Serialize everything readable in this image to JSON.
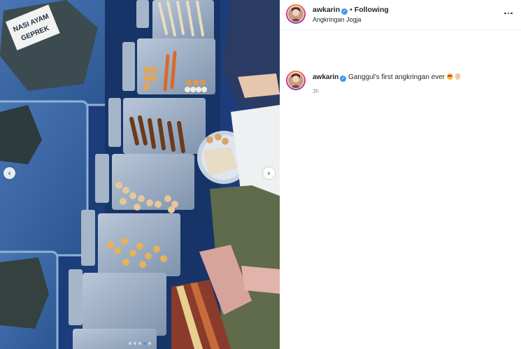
{
  "post": {
    "image_alt": "Overhead view of angkringan food stall with trays of satay skewers",
    "photo_labels": [
      "NASI AYAM",
      "GEPREK"
    ],
    "carousel": {
      "total_slides": 5,
      "active_index": 3
    }
  },
  "header": {
    "username": "awkarin",
    "separator": "•",
    "follow_status": "Following",
    "location": "Angkringan Jogja"
  },
  "caption": {
    "username": "awkarin",
    "text": "Ganggul's first angkringan ever",
    "time": "3h"
  },
  "icons": {
    "verified": "verified-badge-icon",
    "more": "more-options-icon",
    "prev": "chevron-left-icon",
    "next": "chevron-right-icon"
  },
  "colors": {
    "accent": "#3897f0",
    "text": "#262626",
    "muted": "#8e8e8e"
  }
}
